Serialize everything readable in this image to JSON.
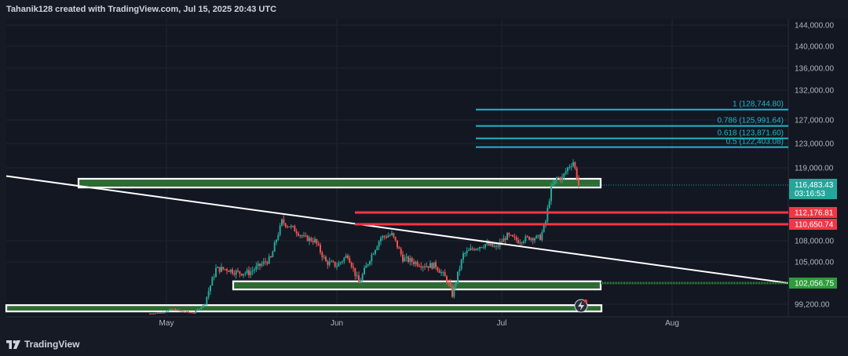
{
  "header": {
    "author": "Tahanik128",
    "created_with": "created with TradingView.com,",
    "timestamp": "Jul 15, 2025 20:43 UTC"
  },
  "footer": {
    "brand": "TradingView",
    "logo_icon": "tradingview-logo-icon"
  },
  "colors": {
    "background": "#161a25",
    "chart_bg": "#131722",
    "grid": "#20242f",
    "axis_text": "#b2b5be",
    "up_candle": "#26a69a",
    "down_candle": "#ef5350",
    "zone_green": "#2e6b32",
    "zone_border": "#ffffff",
    "fib_line": "#22b6c9",
    "resistance_red": "#f23645",
    "trendline": "#ffffff",
    "current_price_badge": "#26a69a",
    "support_badge": "#2e9c3a"
  },
  "chart_data": {
    "type": "candlestick",
    "symbol": "BTC",
    "x_labels": [
      "May",
      "Jun",
      "Jul",
      "Aug"
    ],
    "y_ticks": [
      {
        "value": 144000,
        "label": "144,000.00"
      },
      {
        "value": 140000,
        "label": "140,000.00"
      },
      {
        "value": 136000,
        "label": "136,000.00"
      },
      {
        "value": 132000,
        "label": "132,000.00"
      },
      {
        "value": 127000,
        "label": "127,000.00"
      },
      {
        "value": 123000,
        "label": "123,000.00"
      },
      {
        "value": 119000,
        "label": "119,000.00"
      },
      {
        "value": 108000,
        "label": "108,000.00"
      },
      {
        "value": 105000,
        "label": "105,000.00"
      },
      {
        "value": 99200,
        "label": "99,200.00"
      }
    ],
    "current_price": {
      "value": 116483.43,
      "label": "116,483.43",
      "countdown": "03:16:53"
    },
    "price_path": [
      {
        "t": "Apr 28",
        "p": 94000
      },
      {
        "t": "Apr 30",
        "p": 94500
      },
      {
        "t": "May 2",
        "p": 96500
      },
      {
        "t": "May 4",
        "p": 95000
      },
      {
        "t": "May 6",
        "p": 94500
      },
      {
        "t": "May 8",
        "p": 99500
      },
      {
        "t": "May 10",
        "p": 104000
      },
      {
        "t": "May 12",
        "p": 104000
      },
      {
        "t": "May 14",
        "p": 103500
      },
      {
        "t": "May 16",
        "p": 103500
      },
      {
        "t": "May 18",
        "p": 104500
      },
      {
        "t": "May 20",
        "p": 105500
      },
      {
        "t": "May 22",
        "p": 111000
      },
      {
        "t": "May 24",
        "p": 110000
      },
      {
        "t": "May 26",
        "p": 108500
      },
      {
        "t": "May 28",
        "p": 108000
      },
      {
        "t": "May 30",
        "p": 105000
      },
      {
        "t": "Jun 1",
        "p": 104500
      },
      {
        "t": "Jun 3",
        "p": 106000
      },
      {
        "t": "Jun 5",
        "p": 102000
      },
      {
        "t": "Jun 7",
        "p": 105500
      },
      {
        "t": "Jun 9",
        "p": 108500
      },
      {
        "t": "Jun 11",
        "p": 109000
      },
      {
        "t": "Jun 13",
        "p": 105500
      },
      {
        "t": "Jun 15",
        "p": 105000
      },
      {
        "t": "Jun 17",
        "p": 104500
      },
      {
        "t": "Jun 19",
        "p": 104500
      },
      {
        "t": "Jun 21",
        "p": 102500
      },
      {
        "t": "Jun 22",
        "p": 100500
      },
      {
        "t": "Jun 24",
        "p": 106000
      },
      {
        "t": "Jun 26",
        "p": 107000
      },
      {
        "t": "Jun 28",
        "p": 107500
      },
      {
        "t": "Jun 30",
        "p": 107000
      },
      {
        "t": "Jul 2",
        "p": 108800
      },
      {
        "t": "Jul 4",
        "p": 108000
      },
      {
        "t": "Jul 6",
        "p": 108500
      },
      {
        "t": "Jul 8",
        "p": 108500
      },
      {
        "t": "Jul 9",
        "p": 111000
      },
      {
        "t": "Jul 10",
        "p": 116000
      },
      {
        "t": "Jul 11",
        "p": 117500
      },
      {
        "t": "Jul 12",
        "p": 117500
      },
      {
        "t": "Jul 13",
        "p": 119000
      },
      {
        "t": "Jul 14",
        "p": 120000
      },
      {
        "t": "Jul 15",
        "p": 116483.43
      }
    ],
    "fib_levels": [
      {
        "ratio": "1",
        "price": 128744.8,
        "label": "1 (128,744.80)"
      },
      {
        "ratio": "0.786",
        "price": 125991.64,
        "label": "0.786 (125,991.64)"
      },
      {
        "ratio": "0.618",
        "price": 123871.6,
        "label": "0.618 (123,871.60)"
      },
      {
        "ratio": "0.5",
        "price": 122403.08,
        "label": "0.5 (122,403.08)"
      }
    ],
    "resistance_lines": [
      {
        "price": 112176.81,
        "label": "112,176.81"
      },
      {
        "price": 110650.74,
        "label": "110,650.74"
      }
    ],
    "support_label": {
      "price": 102056.75,
      "label": "102,056.75"
    },
    "zones": [
      {
        "name": "upper-zone",
        "price_top": 117400,
        "price_bottom": 116100
      },
      {
        "name": "mid-zone",
        "price_top": 102300,
        "price_bottom": 101200
      },
      {
        "name": "lower-zone",
        "price_top": 98700,
        "price_bottom": 97300
      }
    ],
    "trendline": {
      "start_price": 117800,
      "end_price": 102056.75
    },
    "grid": true
  }
}
